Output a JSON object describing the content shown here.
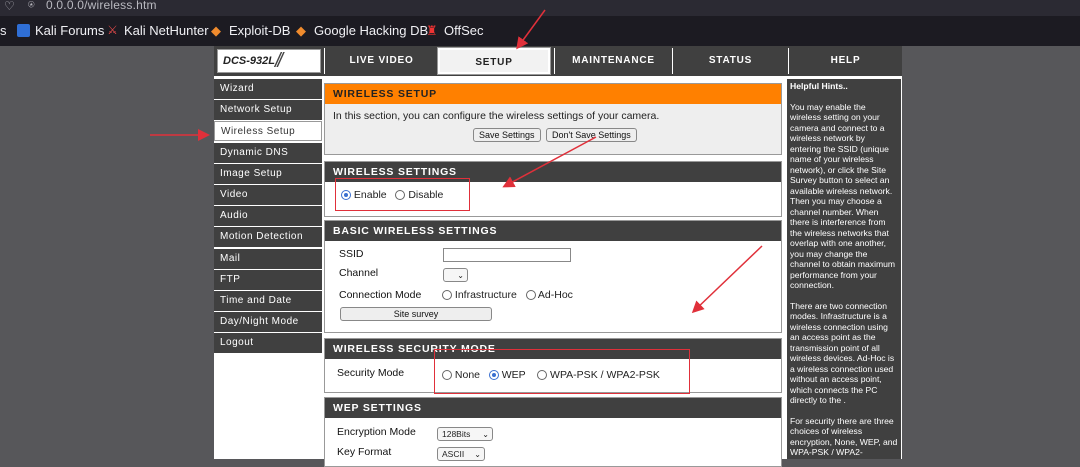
{
  "browser": {
    "url": "0.0.0.0/wireless.htm",
    "bookmarks": [
      {
        "label": "s"
      },
      {
        "label": "Kali Forums",
        "icon": "kali-icon"
      },
      {
        "label": "Kali NetHunter",
        "icon": "nethunter-icon"
      },
      {
        "label": "Exploit-DB",
        "icon": "exploit-db-icon"
      },
      {
        "label": "Google Hacking DB",
        "icon": "ghdb-icon"
      },
      {
        "label": "OffSec",
        "icon": "offsec-icon"
      }
    ]
  },
  "header": {
    "model": "DCS-932L",
    "tabs": [
      {
        "label": "LIVE VIDEO"
      },
      {
        "label": "SETUP",
        "active": true
      },
      {
        "label": "MAINTENANCE"
      },
      {
        "label": "STATUS"
      },
      {
        "label": "HELP"
      }
    ]
  },
  "sidebar": {
    "items": [
      {
        "label": "Wizard"
      },
      {
        "label": "Network Setup"
      },
      {
        "label": "Wireless Setup",
        "active": true
      },
      {
        "label": "Dynamic DNS"
      },
      {
        "label": "Image Setup"
      },
      {
        "label": "Video"
      },
      {
        "label": "Audio"
      },
      {
        "label": "Motion Detection"
      },
      {
        "label": "Mail"
      },
      {
        "label": "FTP"
      },
      {
        "label": "Time and Date"
      },
      {
        "label": "Day/Night Mode"
      },
      {
        "label": "Logout"
      }
    ]
  },
  "wireless_setup": {
    "title": "WIRELESS SETUP",
    "description": "In this section, you can configure the wireless settings of your camera.",
    "save_label": "Save Settings",
    "dont_save_label": "Don't Save Settings"
  },
  "wireless_settings": {
    "title": "WIRELESS SETTINGS",
    "enable_label": "Enable",
    "disable_label": "Disable",
    "selected": "Enable"
  },
  "basic": {
    "title": "BASIC WIRELESS SETTINGS",
    "ssid_label": "SSID",
    "ssid_value": "",
    "channel_label": "Channel",
    "channel_value": "",
    "connection_mode_label": "Connection Mode",
    "infrastructure_label": "Infrastructure",
    "adhoc_label": "Ad-Hoc",
    "site_survey_label": "Site survey"
  },
  "security": {
    "title": "WIRELESS SECURITY MODE",
    "mode_label": "Security Mode",
    "none_label": "None",
    "wep_label": "WEP",
    "wpa_label": "WPA-PSK / WPA2-PSK",
    "selected": "WEP"
  },
  "wep": {
    "title": "WEP SETTINGS",
    "encryption_label": "Encryption Mode",
    "encryption_value": "128Bits",
    "key_format_label": "Key Format",
    "key_format_value": "ASCII"
  },
  "hints": {
    "title": "Helpful Hints..",
    "p1": "You may enable the wireless setting on your camera and connect to a wireless network by entering the SSID (unique name of your wireless network), or click the Site Survey button to select an available wireless network. Then you may choose a channel number. When there is interference from the wireless networks that overlap with one another, you may change the channel to obtain maximum performance from your connection.",
    "p2": "There are two connection modes. Infrastructure is a wireless connection using an access point as the transmission point of all wireless devices. Ad-Hoc is a wireless connection used without an access point, which connects the PC directly to the .",
    "p3": "For security there are three choices of wireless encryption, None, WEP, and WPA-PSK / WPA2-"
  },
  "colors": {
    "annotation": "#e0303a",
    "orange_header": "#ff8000",
    "dark_header": "#404040"
  }
}
